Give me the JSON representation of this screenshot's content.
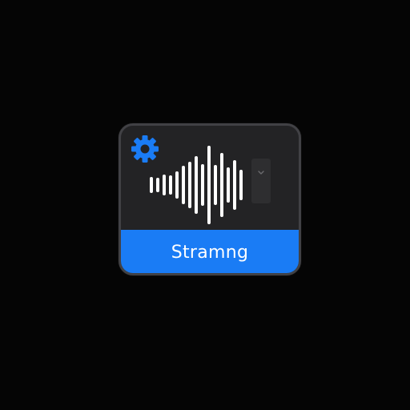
{
  "widget": {
    "status_label": "Stramng",
    "icons": {
      "settings": "gear-icon",
      "waveform": "audio-waveform-icon",
      "dropdown": "chevron-down-icon"
    },
    "colors": {
      "accent": "#1a7cf5",
      "panel": "#232325",
      "border": "#414145",
      "waveform": "#ffffff",
      "gear": "#1a7cf5"
    }
  }
}
